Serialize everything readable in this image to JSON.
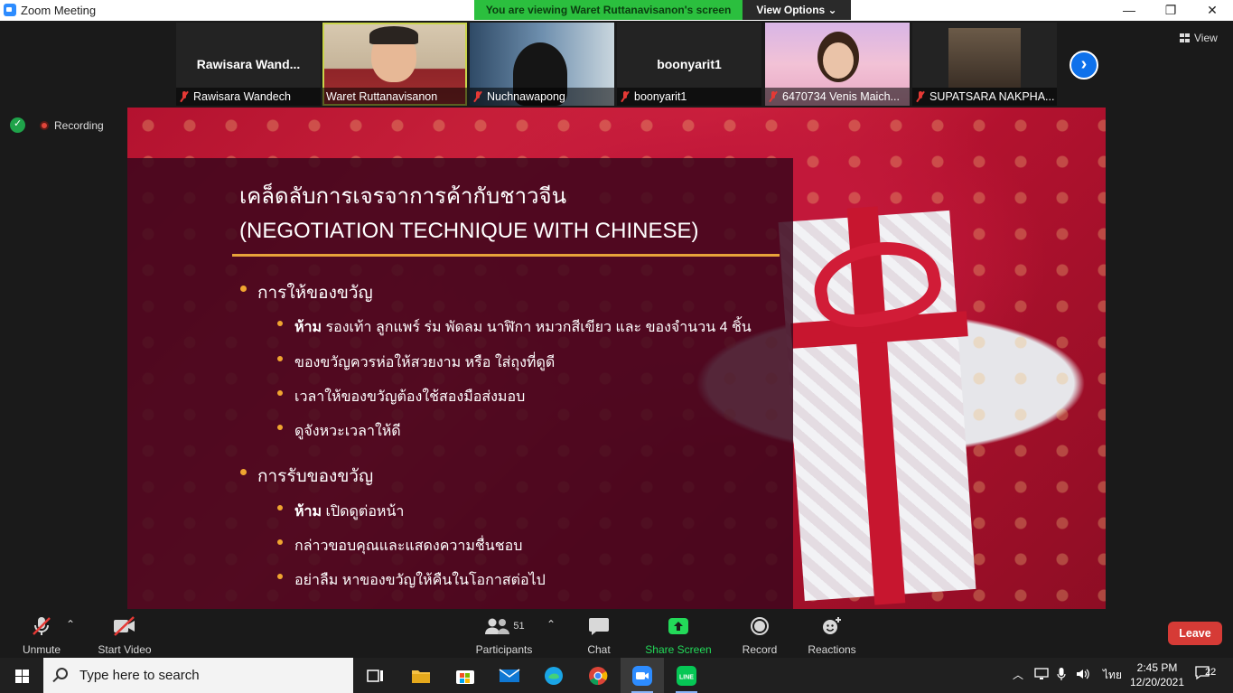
{
  "window": {
    "title": "Zoom Meeting",
    "minimize": "—",
    "restore": "❐",
    "close": "✕"
  },
  "banner": {
    "text": "You are viewing Waret Ruttanavisanon's screen",
    "view_options": "View Options ⌄"
  },
  "view_button": "View",
  "participants_strip": [
    {
      "big_name": "Rawisara  Wand...",
      "name": "Rawisara Wandech",
      "muted": true,
      "video": false
    },
    {
      "big_name": "",
      "name": "Waret Ruttanavisanon",
      "muted": false,
      "video": true,
      "active": true
    },
    {
      "big_name": "",
      "name": "Nuchnawapong",
      "muted": true,
      "video": true
    },
    {
      "big_name": "boonyarit1",
      "name": "boonyarit1",
      "muted": true,
      "video": false
    },
    {
      "big_name": "",
      "name": "6470734 Venis Maich...",
      "muted": true,
      "video": true
    },
    {
      "big_name": "",
      "name": "SUPATSARA NAKPHA...",
      "muted": true,
      "video": true
    }
  ],
  "status": {
    "recording": "Recording"
  },
  "slide": {
    "title_line1": "เคล็ดลับการเจรจาการค้ากับชาวจีน",
    "title_line2": "(NEGOTIATION TECHNIQUE WITH CHINESE)",
    "sections": [
      {
        "heading": "การให้ของขวัญ",
        "items": [
          {
            "bold": "ห้าม",
            "text": " รองเท้า ลูกแพร์ ร่ม พัดลม นาฬิกา หมวกสีเขียว และ ของจำนวน 4 ชิ้น"
          },
          {
            "bold": "",
            "text": "ของขวัญควรห่อให้สวยงาม หรือ ใส่ถุงที่ดูดี"
          },
          {
            "bold": "",
            "text": "เวลาให้ของขวัญต้องใช้สองมือส่งมอบ"
          },
          {
            "bold": "",
            "text": "ดูจังหวะเวลาให้ดี"
          }
        ]
      },
      {
        "heading": "การรับของขวัญ",
        "items": [
          {
            "bold": "ห้าม",
            "text": " เปิดดูต่อหน้า"
          },
          {
            "bold": "",
            "text": "กล่าวขอบคุณและแสดงความชื่นชอบ"
          },
          {
            "bold": "",
            "text": "อย่าลืม หาของขวัญให้คืนในโอกาสต่อไป"
          }
        ]
      }
    ]
  },
  "toolbar": {
    "unmute": "Unmute",
    "start_video": "Start Video",
    "participants": "Participants",
    "participants_count": "51",
    "chat": "Chat",
    "share_screen": "Share Screen",
    "record": "Record",
    "reactions": "Reactions",
    "leave": "Leave"
  },
  "taskbar": {
    "search_placeholder": "Type here to search",
    "language": "ไทย",
    "time": "2:45 PM",
    "date": "12/20/2021",
    "notifications": "22"
  },
  "colors": {
    "accent": "#2d8cff",
    "banner": "#2bbf3e",
    "leave": "#d63b36",
    "share": "#23d959",
    "rule": "#e8a33a"
  }
}
